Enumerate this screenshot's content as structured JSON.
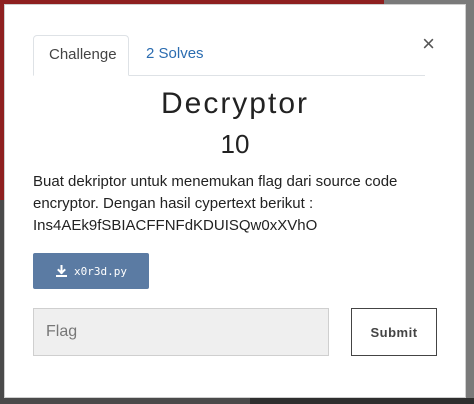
{
  "tabs": [
    {
      "label": "Challenge"
    },
    {
      "label": "2 Solves"
    }
  ],
  "close_icon": "×",
  "challenge": {
    "name": "Decryptor",
    "points": "10",
    "description_lines": [
      "Buat dekriptor untuk menemukan flag dari source code",
      "encryptor. Dengan hasil cypertext berikut :",
      "Ins4AEk9fSBIACFFNFdKDUISQw0xXVhO"
    ]
  },
  "file": {
    "icon": "download-icon",
    "name": "x0r3d.py"
  },
  "flag_input": {
    "placeholder": "Flag",
    "value": ""
  },
  "submit_label": "Submit",
  "colors": {
    "file_button": "#5b7ba3",
    "tab_link": "#2b6cb0",
    "overlay_red": "#8e1f1f"
  }
}
